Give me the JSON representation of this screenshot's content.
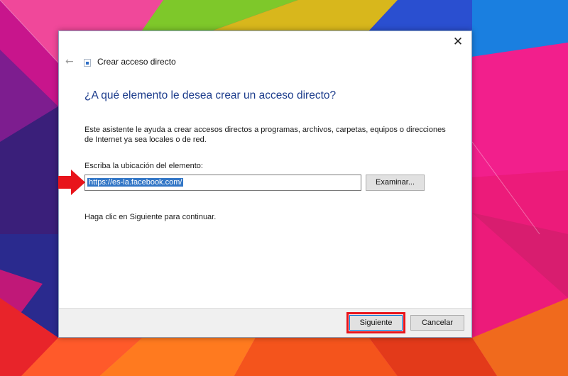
{
  "window": {
    "title": "Crear acceso directo",
    "back_icon": "arrow-left-icon",
    "close_icon": "close-icon",
    "close_glyph": "✕",
    "back_glyph": "←"
  },
  "content": {
    "heading": "¿A qué elemento le desea crear un acceso directo?",
    "description": "Este asistente le ayuda a crear accesos directos a programas, archivos, carpetas, equipos o direcciones de Internet ya sea locales o de red.",
    "location_label": "Escriba la ubicación del elemento:",
    "location_value": "https://es-la.facebook.com/",
    "browse_label": "Examinar...",
    "hint": "Haga clic en Siguiente para continuar."
  },
  "footer": {
    "next_label": "Siguiente",
    "cancel_label": "Cancelar"
  },
  "annotations": {
    "arrow_color": "#e8141b",
    "highlight_color": "#e8141b"
  },
  "colors": {
    "heading": "#1c3c8c",
    "selection": "#3276c6",
    "accent": "#0078d7"
  }
}
